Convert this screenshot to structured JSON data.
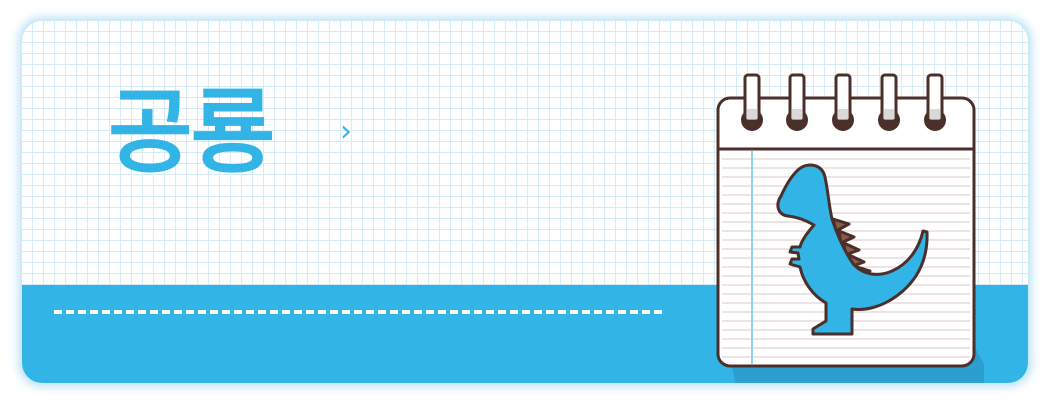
{
  "banner": {
    "title": "공룡",
    "more_glyph": "›",
    "colors": {
      "accent": "#33b4e7",
      "grid_line": "#d3ecf8",
      "outline": "#4a2f2a",
      "paper": "#ffffff",
      "ruled_line": "#d8c8c8",
      "spine": "#8fd0ef",
      "dino_spikes": "#8b5a4a"
    },
    "icons": [
      "notebook-icon",
      "dinosaur-icon",
      "chevron-right-icon"
    ]
  }
}
